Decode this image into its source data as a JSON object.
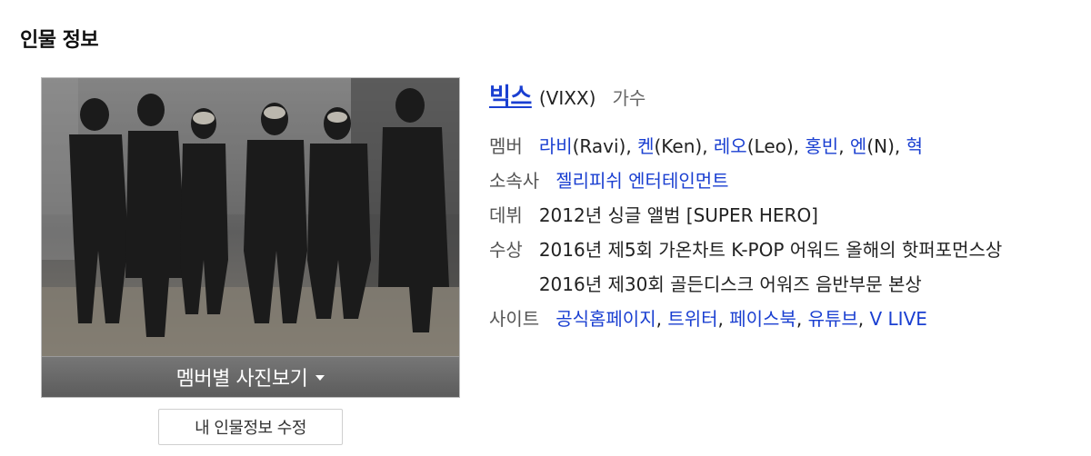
{
  "section": {
    "title": "인물 정보"
  },
  "photo": {
    "alt": "빅스 그룹 사진",
    "button_label": "멤버별 사진보기"
  },
  "edit": {
    "label": "내 인물정보 수정"
  },
  "profile": {
    "name": "빅스",
    "name_en": "(VIXX)",
    "role": "가수",
    "link_color": "#1a3fd1"
  },
  "members": {
    "label": "멤버",
    "items": [
      {
        "name": "라비",
        "suffix": "(Ravi)"
      },
      {
        "name": "켄",
        "suffix": "(Ken)"
      },
      {
        "name": "레오",
        "suffix": "(Leo)"
      },
      {
        "name": "홍빈",
        "suffix": ""
      },
      {
        "name": "엔",
        "suffix": "(N)"
      },
      {
        "name": "혁",
        "suffix": ""
      }
    ]
  },
  "agency": {
    "label": "소속사",
    "value": "젤리피쉬 엔터테인먼트"
  },
  "debut": {
    "label": "데뷔",
    "value": "2012년 싱글 앨범 [SUPER HERO]"
  },
  "awards": {
    "label": "수상",
    "items": [
      "2016년 제5회 가온차트 K-POP 어워드 올해의 핫퍼포먼스상",
      "2016년 제30회 골든디스크 어워즈 음반부문 본상"
    ]
  },
  "sites": {
    "label": "사이트",
    "items": [
      "공식홈페이지",
      "트위터",
      "페이스북",
      "유튜브",
      "V LIVE"
    ]
  }
}
